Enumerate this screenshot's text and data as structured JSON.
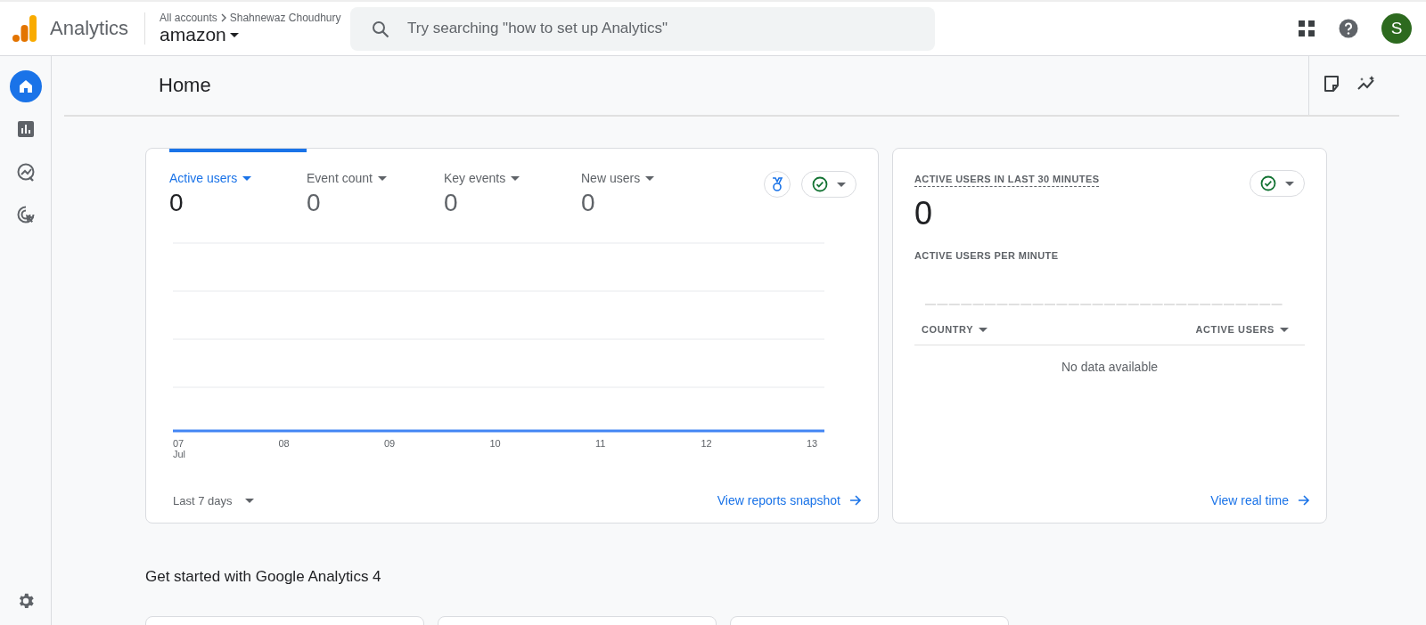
{
  "app": {
    "name": "Analytics"
  },
  "account": {
    "breadcrumb_root": "All accounts",
    "breadcrumb_account": "Shahnewaz Choudhury",
    "property": "amazon"
  },
  "search": {
    "placeholder": "Try searching \"how to set up Analytics\""
  },
  "user": {
    "avatar_letter": "S"
  },
  "sidebar": {
    "items": [
      {
        "kind": "home",
        "selected": true
      },
      {
        "kind": "reports",
        "selected": false
      },
      {
        "kind": "explore",
        "selected": false
      },
      {
        "kind": "advertising",
        "selected": false
      }
    ]
  },
  "page": {
    "title": "Home"
  },
  "overview": {
    "metrics": [
      {
        "label": "Active users",
        "value": "0",
        "selected": true
      },
      {
        "label": "Event count",
        "value": "0",
        "selected": false
      },
      {
        "label": "Key events",
        "value": "0",
        "selected": false
      },
      {
        "label": "New users",
        "value": "0",
        "selected": false
      }
    ],
    "x_axis_labels": [
      {
        "day": "07",
        "month": "Jul"
      },
      {
        "day": "08"
      },
      {
        "day": "09"
      },
      {
        "day": "10"
      },
      {
        "day": "11"
      },
      {
        "day": "12"
      },
      {
        "day": "13"
      }
    ],
    "date_range": "Last 7 days",
    "link": "View reports snapshot"
  },
  "realtime": {
    "title": "ACTIVE USERS IN LAST 30 MINUTES",
    "value": "0",
    "subtitle": "ACTIVE USERS PER MINUTE",
    "columns": [
      "COUNTRY",
      "ACTIVE USERS"
    ],
    "empty_message": "No data available",
    "link": "View real time"
  },
  "section": {
    "heading": "Get started with Google Analytics 4"
  }
}
